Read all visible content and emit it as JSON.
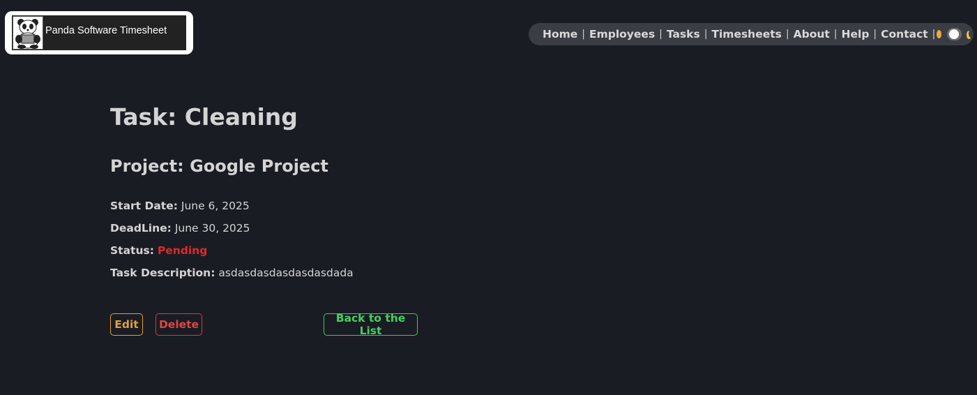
{
  "brand": {
    "name": "Panda Software Timesheet"
  },
  "nav": {
    "items": [
      "Home",
      "Employees",
      "Tasks",
      "Timesheets",
      "About",
      "Help",
      "Contact"
    ],
    "separator": "|"
  },
  "task": {
    "title": "Task: Cleaning",
    "project": "Project: Google Project",
    "start_date_label": "Start Date:",
    "start_date": "June 6, 2025",
    "deadline_label": "DeadLine:",
    "deadline": "June 30, 2025",
    "status_label": "Status:",
    "status": "Pending",
    "description_label": "Task Description:",
    "description": "asdasdasdasdasdasdada"
  },
  "actions": {
    "edit": "Edit",
    "delete": "Delete",
    "back": "Back to the List"
  },
  "colors": {
    "background": "#1a1c23",
    "status_pending": "#dd2a2a",
    "edit": "#e0a13a",
    "delete": "#e04545",
    "back": "#45d160"
  },
  "theme_toggle": {
    "icons": [
      "sun-icon",
      "moon-icon"
    ],
    "state": "dark"
  }
}
